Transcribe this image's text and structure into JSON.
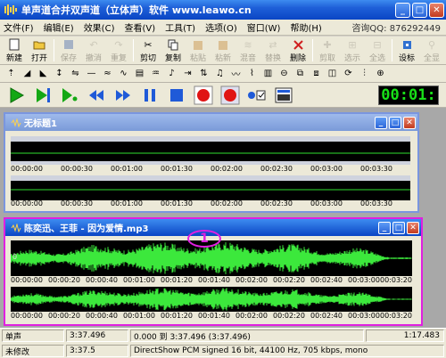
{
  "window": {
    "title": "单声道合并双声道（立体声）软件 www.leawo.cn"
  },
  "menu": {
    "items": [
      "文件(F)",
      "编辑(E)",
      "效果(C)",
      "查看(V)",
      "工具(T)",
      "选项(O)",
      "窗口(W)",
      "帮助(H)"
    ],
    "consult": "咨询QQ: 876292449"
  },
  "toolbar": {
    "buttons": [
      {
        "label": "新建",
        "icon": "new-file-icon",
        "enabled": true
      },
      {
        "label": "打开",
        "icon": "open-folder-icon",
        "enabled": true
      },
      {
        "label": "保存",
        "icon": "save-icon",
        "enabled": false
      },
      {
        "label": "撤消",
        "icon": "undo-icon",
        "enabled": false
      },
      {
        "label": "重复",
        "icon": "redo-icon",
        "enabled": false
      },
      {
        "label": "剪切",
        "icon": "cut-icon",
        "enabled": true
      },
      {
        "label": "复制",
        "icon": "copy-icon",
        "enabled": true
      },
      {
        "label": "粘贴",
        "icon": "paste-icon",
        "enabled": false
      },
      {
        "label": "粘新",
        "icon": "paste-new-icon",
        "enabled": false
      },
      {
        "label": "混音",
        "icon": "mix-icon",
        "enabled": false
      },
      {
        "label": "替换",
        "icon": "replace-icon",
        "enabled": false
      },
      {
        "label": "删除",
        "icon": "delete-icon",
        "enabled": true
      },
      {
        "label": "剪取",
        "icon": "trim-icon",
        "enabled": false
      },
      {
        "label": "选示",
        "icon": "select-view-icon",
        "enabled": false
      },
      {
        "label": "全选",
        "icon": "select-all-icon",
        "enabled": false
      },
      {
        "label": "设标",
        "icon": "marker-icon",
        "enabled": true
      },
      {
        "label": "全显",
        "icon": "show-all-icon",
        "enabled": false
      }
    ]
  },
  "transport": {
    "time": "00:01:"
  },
  "tracks": [
    {
      "title": "无标题1",
      "time_labels": [
        "00:00:00",
        "00:00:30",
        "00:01:00",
        "00:01:30",
        "00:02:00",
        "00:02:30",
        "00:03:00",
        "00:03:30"
      ]
    },
    {
      "title": "陈奕迅、王菲 - 因为爱情.mp3",
      "marker": "1",
      "time_labels": [
        "00:00:00",
        "00:00:20",
        "00:00:40",
        "00:01:00",
        "00:01:20",
        "00:01:40",
        "00:02:00",
        "00:02:20",
        "00:02:40",
        "00:03:00",
        "00:03:20"
      ],
      "zero_label": "0"
    }
  ],
  "status": {
    "row1": {
      "mode": "单声",
      "length": "3:37.496",
      "range": "0.000 到 3:37.496 (3:37.496)",
      "size": "1:17.483"
    },
    "row2": {
      "modified": "未修改",
      "position": "3:37.5",
      "format": "DirectShow PCM signed 16 bit, 44100 Hz, 705 kbps, mono"
    }
  }
}
